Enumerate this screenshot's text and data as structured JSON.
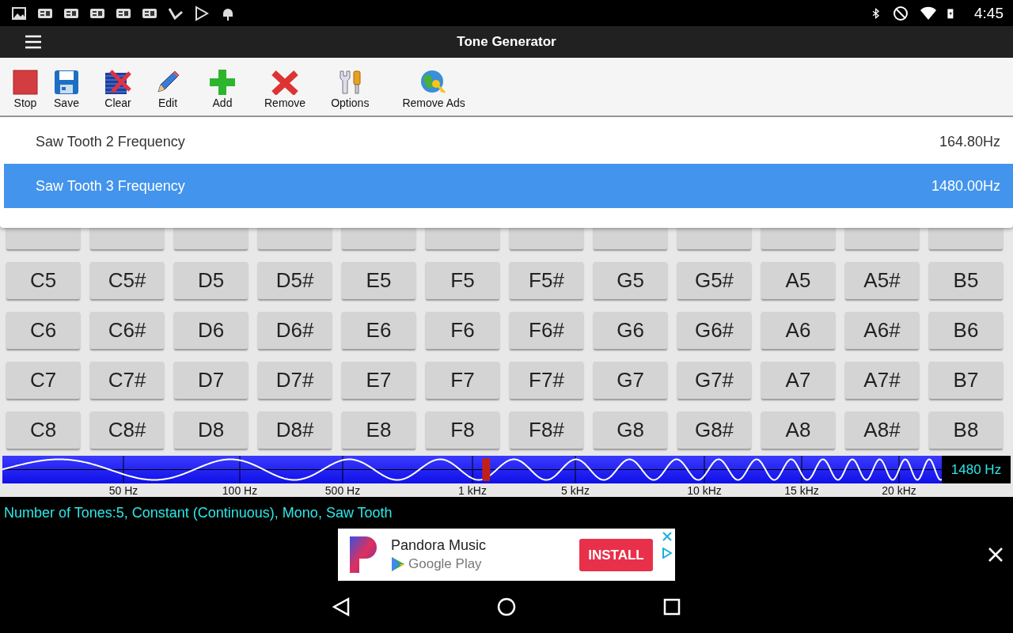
{
  "status_bar": {
    "time": "4:45"
  },
  "app_bar": {
    "title": "Tone Generator"
  },
  "toolbar": [
    {
      "label": "Stop",
      "kind": "stop"
    },
    {
      "label": "Save",
      "kind": "save"
    },
    {
      "label": "Clear",
      "kind": "clear"
    },
    {
      "label": "Edit",
      "kind": "edit"
    },
    {
      "label": "Add",
      "kind": "add"
    },
    {
      "label": "Remove",
      "kind": "remove"
    },
    {
      "label": "Options",
      "kind": "options"
    },
    {
      "label": "Remove Ads",
      "kind": "remove_ads"
    }
  ],
  "tone_list": [
    {
      "name": "Saw Tooth 2 Frequency",
      "value": "164.80Hz",
      "selected": false
    },
    {
      "name": "Saw Tooth 3 Frequency",
      "value": "1480.00Hz",
      "selected": true
    }
  ],
  "note_keys": [
    [
      "C5",
      "C5#",
      "D5",
      "D5#",
      "E5",
      "F5",
      "F5#",
      "G5",
      "G5#",
      "A5",
      "A5#",
      "B5"
    ],
    [
      "C6",
      "C6#",
      "D6",
      "D6#",
      "E6",
      "F6",
      "F6#",
      "G6",
      "G6#",
      "A6",
      "A6#",
      "B6"
    ],
    [
      "C7",
      "C7#",
      "D7",
      "D7#",
      "E7",
      "F7",
      "F7#",
      "G7",
      "G7#",
      "A7",
      "A7#",
      "B7"
    ],
    [
      "C8",
      "C8#",
      "D8",
      "D8#",
      "E8",
      "F8",
      "F8#",
      "G8",
      "G8#",
      "A8",
      "A8#",
      "B8"
    ]
  ],
  "frequency_slider": {
    "level": 0.515,
    "readout": "1480 Hz",
    "scale_labels": [
      "50 Hz",
      "100 Hz",
      "500 Hz",
      "1 kHz",
      "5 kHz",
      "10 kHz",
      "15 kHz",
      "20 kHz"
    ]
  },
  "summary": "Number of Tones:5, Constant (Continuous), Mono, Saw Tooth",
  "ad": {
    "title": "Pandora Music",
    "store": "Google Play",
    "button": "INSTALL"
  }
}
